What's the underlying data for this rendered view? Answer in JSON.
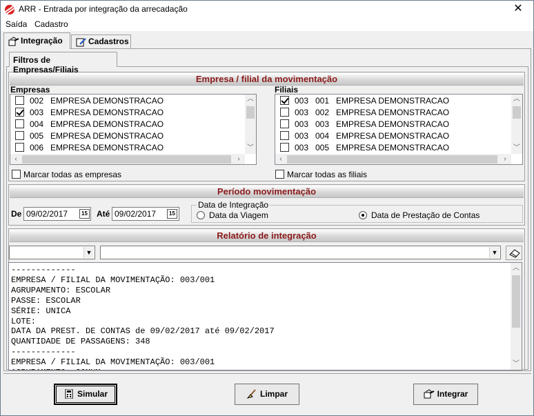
{
  "window": {
    "title": "ARR - Entrada por integração da arrecadação",
    "close_glyph": "✕"
  },
  "menu": [
    "Saída",
    "Cadastro"
  ],
  "tabs": [
    {
      "label": "Integração",
      "icon": "integration-icon",
      "active": true
    },
    {
      "label": "Cadastros",
      "icon": "edit-icon",
      "active": false
    }
  ],
  "subtab": {
    "label": "Filtros de Empresas/Filiais"
  },
  "empresa_section": {
    "title": "Empresa / filial  da movimentação",
    "empresas_label": "Empresas",
    "filiais_label": "Filiais",
    "empresas": [
      {
        "code": "002",
        "name": "EMPRESA DEMONSTRACAO",
        "checked": false
      },
      {
        "code": "003",
        "name": "EMPRESA DEMONSTRACAO",
        "checked": true
      },
      {
        "code": "004",
        "name": "EMPRESA DEMONSTRACAO",
        "checked": false
      },
      {
        "code": "005",
        "name": "EMPRESA DEMONSTRACAO",
        "checked": false
      },
      {
        "code": "006",
        "name": "EMPRESA DEMONSTRACAO",
        "checked": false
      }
    ],
    "filiais": [
      {
        "emp": "003",
        "code": "001",
        "name": "EMPRESA DEMONSTRACAO",
        "checked": true
      },
      {
        "emp": "003",
        "code": "002",
        "name": "EMPRESA DEMONSTRACAO",
        "checked": false
      },
      {
        "emp": "003",
        "code": "003",
        "name": "EMPRESA DEMONSTRACAO",
        "checked": false
      },
      {
        "emp": "003",
        "code": "004",
        "name": "EMPRESA DEMONSTRACAO",
        "checked": false
      },
      {
        "emp": "003",
        "code": "005",
        "name": "EMPRESA DEMONSTRACAO",
        "checked": false
      }
    ],
    "marcar_empresas": "Marcar todas as empresas",
    "marcar_filiais": "Marcar todas as filiais"
  },
  "periodo_section": {
    "title": "Período movimentação",
    "de_label": "De",
    "ate_label": "Até",
    "de_value": "09/02/2017",
    "ate_value": "09/02/2017",
    "cal_glyph": "15",
    "data_integracao_legend": "Data de Integração",
    "options": [
      {
        "label": "Data da Viagem",
        "selected": false
      },
      {
        "label": "Data de Prestação de Contas",
        "selected": true
      }
    ]
  },
  "relatorio_section": {
    "title": "Relatório de integração",
    "combo1_value": "",
    "combo2_value": "",
    "lines": [
      "-------------",
      "EMPRESA / FILIAL DA MOVIMENTAÇÃO: 003/001",
      "AGRUPAMENTO: ESCOLAR",
      "PASSE: ESCOLAR",
      "SÉRIE: UNICA",
      "LOTE:",
      "DATA DA PREST. DE CONTAS de 09/02/2017 até 09/02/2017",
      "QUANTIDADE DE PASSAGENS: 348",
      "-------------",
      "EMPRESA / FILIAL DA MOVIMENTAÇÃO: 003/001",
      "AGRUPAMENTO: COMUM"
    ]
  },
  "buttons": {
    "simular": "Simular",
    "limpar": "Limpar",
    "integrar": "Integrar"
  },
  "colors": {
    "section_title": "#8b1a1a",
    "app_icon": "#d9211e"
  }
}
